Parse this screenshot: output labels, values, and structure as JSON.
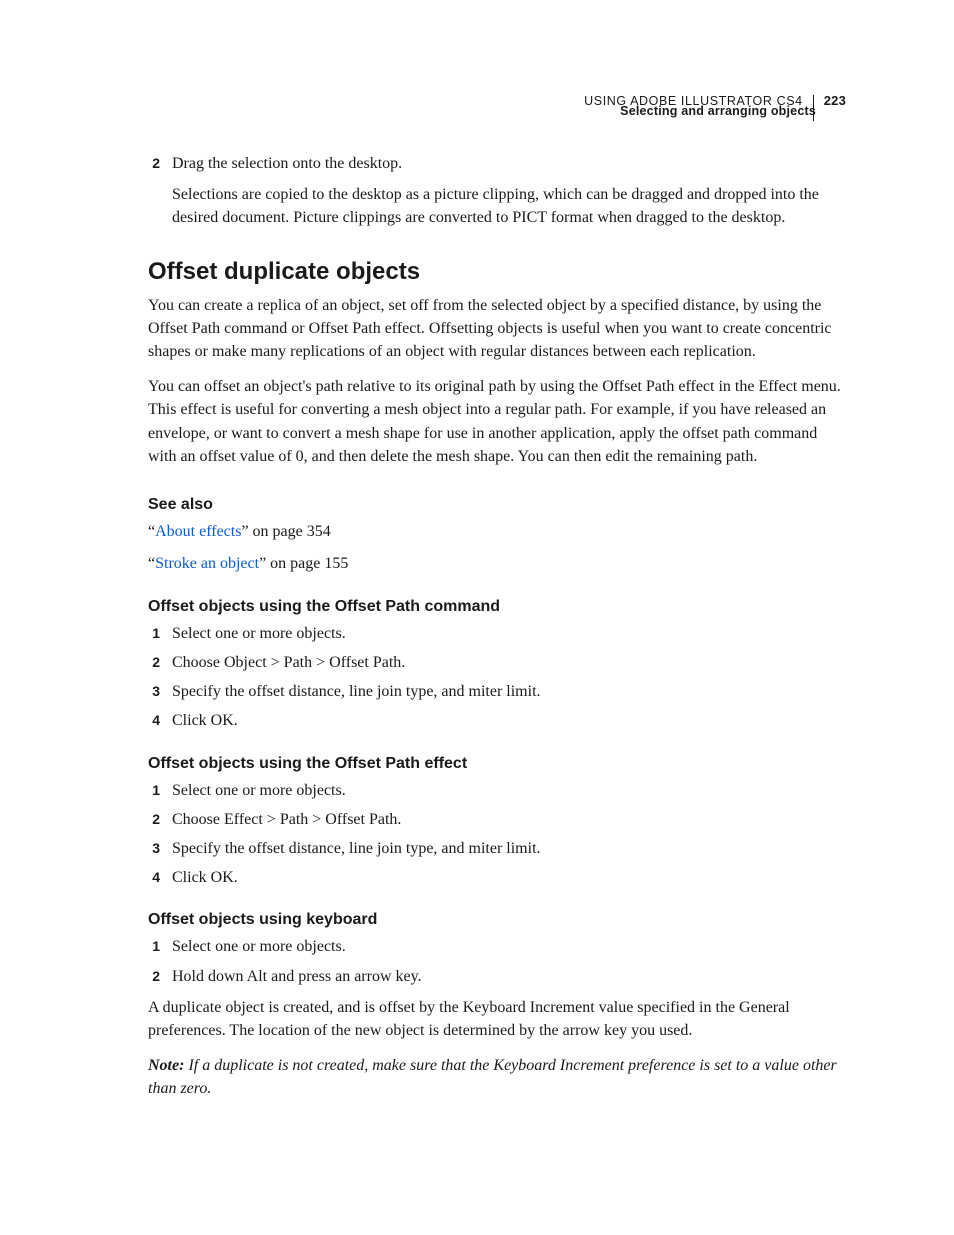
{
  "header": {
    "doc_title": "USING ADOBE ILLUSTRATOR CS4",
    "page_number": "223",
    "section_title": "Selecting and arranging objects"
  },
  "top_steps": [
    {
      "n": "2",
      "text": "Drag the selection onto the desktop."
    }
  ],
  "top_followup": "Selections are copied to the desktop as a picture clipping, which can be dragged and dropped into the desired document. Picture clippings are converted to PICT format when dragged to the desktop.",
  "section": {
    "heading": "Offset duplicate objects",
    "para1": "You can create a replica of an object, set off from the selected object by a specified distance, by using the Offset Path command or Offset Path effect. Offsetting objects is useful when you want to create concentric shapes or make many replications of an object with regular distances between each replication.",
    "para2": "You can offset an object's path relative to its original path by using the Offset Path effect in the Effect menu. This effect is useful for converting a mesh object into a regular path. For example, if you have released an envelope, or want to convert a mesh shape for use in another application, apply the offset path command with an offset value of 0, and then delete the mesh shape. You can then edit the remaining path."
  },
  "see_also": {
    "heading": "See also",
    "items": [
      {
        "pre": "“",
        "link": "About effects",
        "post": "” on page 354"
      },
      {
        "pre": "“",
        "link": "Stroke an object",
        "post": "” on page 155"
      }
    ]
  },
  "sub1": {
    "heading": "Offset objects using the Offset Path command",
    "steps": [
      {
        "n": "1",
        "text": "Select one or more objects."
      },
      {
        "n": "2",
        "text": "Choose Object > Path > Offset Path."
      },
      {
        "n": "3",
        "text": "Specify the offset distance, line join type, and miter limit."
      },
      {
        "n": "4",
        "text": "Click OK."
      }
    ]
  },
  "sub2": {
    "heading": "Offset objects using the Offset Path effect",
    "steps": [
      {
        "n": "1",
        "text": "Select one or more objects."
      },
      {
        "n": "2",
        "text": "Choose Effect > Path > Offset Path."
      },
      {
        "n": "3",
        "text": "Specify the offset distance, line join type, and miter limit."
      },
      {
        "n": "4",
        "text": "Click OK."
      }
    ]
  },
  "sub3": {
    "heading": "Offset objects using keyboard",
    "steps": [
      {
        "n": "1",
        "text": "Select one or more objects."
      },
      {
        "n": "2",
        "text": "Hold down Alt and press an arrow key."
      }
    ],
    "para": "A duplicate object is created, and is offset by the Keyboard Increment value specified in the General preferences. The location of the new object is determined by the arrow key you used.",
    "note_label": "Note:",
    "note_body": " If a duplicate is not created, make sure that the Keyboard Increment preference is set to a value other than zero."
  }
}
